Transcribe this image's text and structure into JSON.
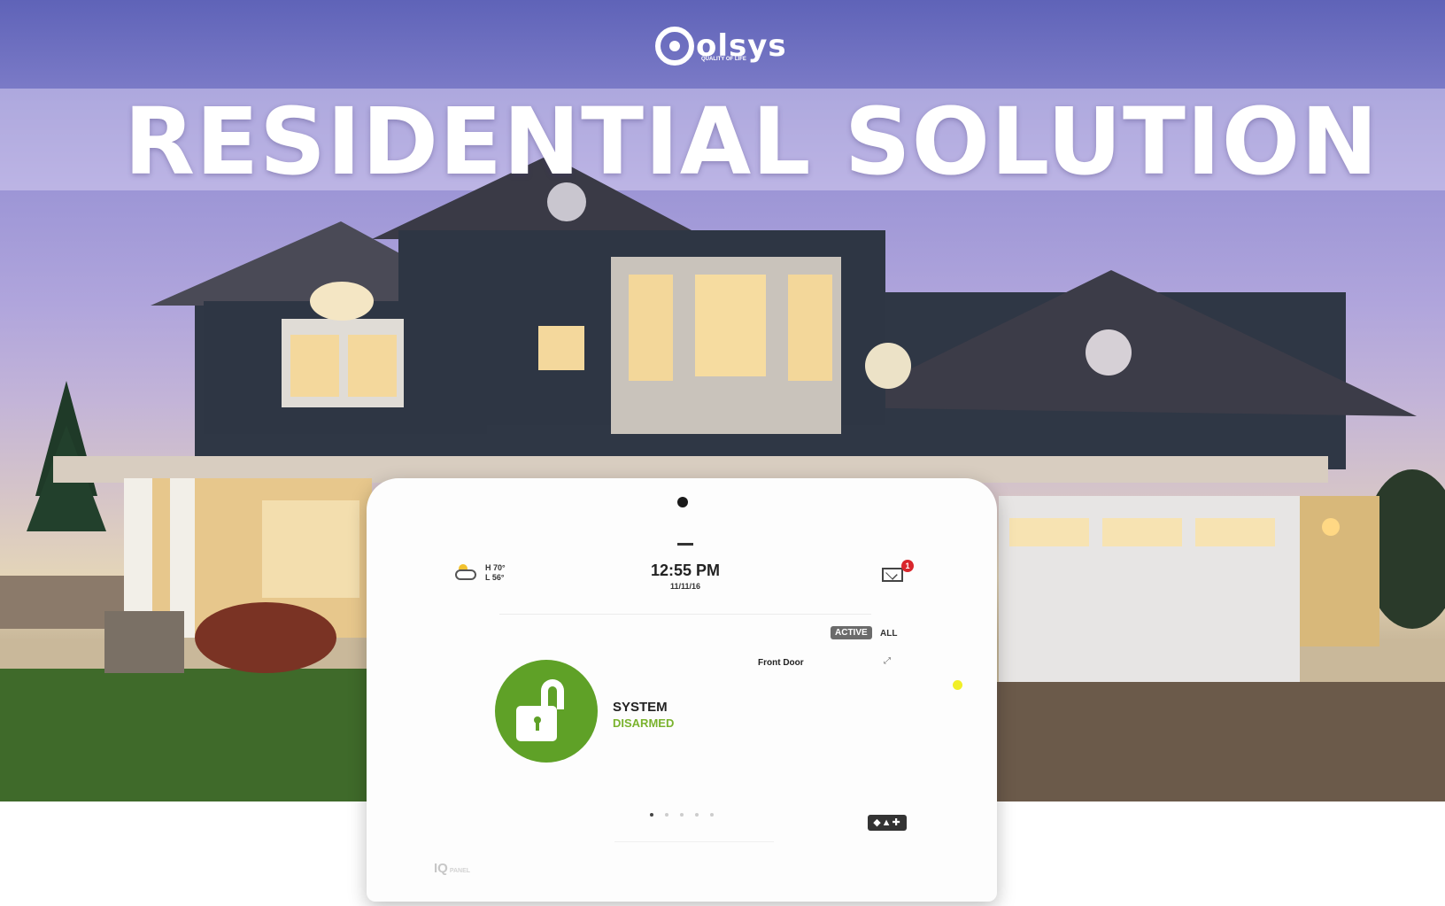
{
  "header": {
    "brand": "olsys",
    "tagline": "QUALITY OF LIFE",
    "headline": "RESIDENTIAL SOLUTION"
  },
  "panel": {
    "weather": {
      "icon": "partly-cloudy-icon",
      "high": "H 70°",
      "low": "L 56°"
    },
    "clock": {
      "time": "12:55 PM",
      "date": "11/11/16"
    },
    "messages": {
      "icon": "mail-icon",
      "count": "1"
    },
    "filters": {
      "active_label": "ACTIVE",
      "all_label": "ALL"
    },
    "sensors": [
      {
        "name": "Front Door",
        "icon": "door-icon"
      }
    ],
    "system": {
      "label": "SYSTEM",
      "state": "DISARMED",
      "icon": "unlocked-padlock-icon",
      "color": "#5fa127"
    },
    "pages": {
      "current": 1,
      "total": 5
    },
    "quick_actions_icon": "shield-flame-plus-icon",
    "brand_mark": "IQ",
    "brand_text": "PANEL"
  },
  "colors": {
    "sky_top": "#5f63b8",
    "disarmed_green": "#5fa127",
    "alert_red": "#d9262c",
    "status_yellow": "#f1ef28"
  }
}
